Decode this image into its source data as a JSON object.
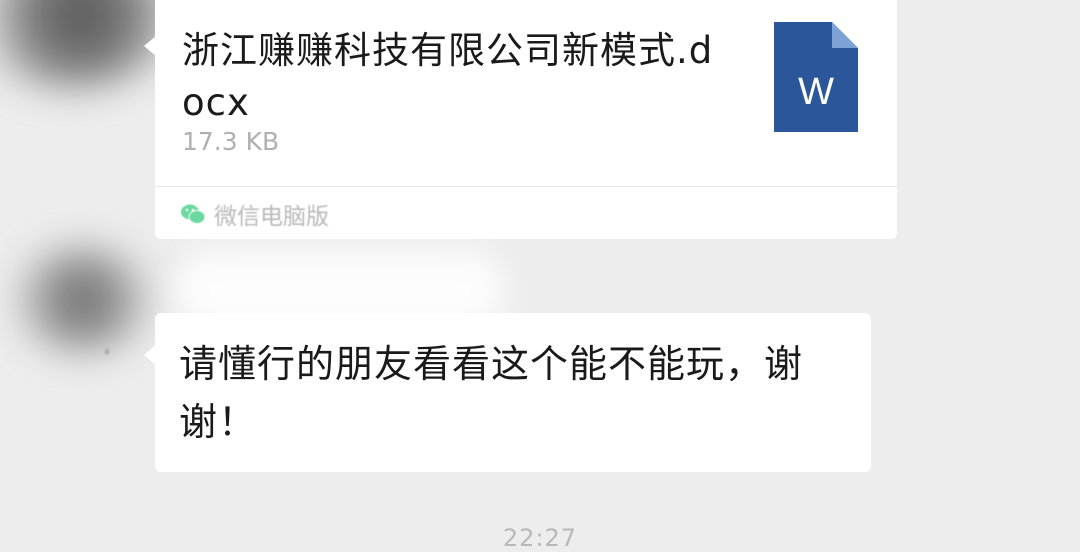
{
  "file_message": {
    "file_name": "浙江赚赚科技有限公司新模式.docx",
    "file_size": "17.3 KB",
    "file_icon": "word-document-icon",
    "file_icon_letter": "W",
    "source_label": "微信电脑版",
    "source_icon": "wechat-icon"
  },
  "text_message": {
    "text": "请懂行的朋友看看这个能不能玩，谢谢！"
  },
  "timestamp": "22:27",
  "colors": {
    "background": "#ededed",
    "bubble": "#ffffff",
    "word_blue": "#2b579a",
    "wechat_green": "#07c160"
  }
}
